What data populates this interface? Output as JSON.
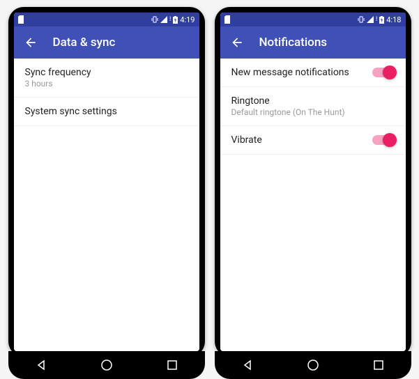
{
  "phones": [
    {
      "status_time": "4:19",
      "appbar_title": "Data & sync",
      "items": [
        {
          "title": "Sync frequency",
          "subtitle": "3 hours",
          "toggle": false
        },
        {
          "title": "System sync settings",
          "subtitle": "",
          "toggle": false
        }
      ]
    },
    {
      "status_time": "4:18",
      "appbar_title": "Notifications",
      "items": [
        {
          "title": "New message notifications",
          "subtitle": "",
          "toggle": true,
          "on": true
        },
        {
          "title": "Ringtone",
          "subtitle": "Default ringtone (On The Hunt)",
          "toggle": false
        },
        {
          "title": "Vibrate",
          "subtitle": "",
          "toggle": true,
          "on": true
        }
      ]
    }
  ],
  "colors": {
    "primary": "#3F51B5",
    "primary_dark": "#303F9F",
    "accent": "#E91E63"
  }
}
